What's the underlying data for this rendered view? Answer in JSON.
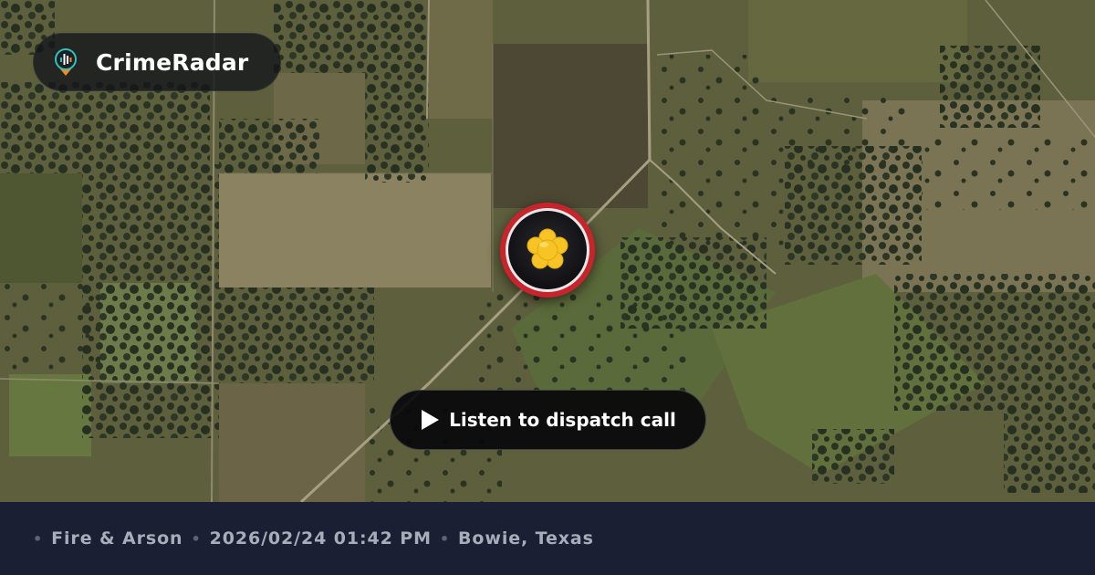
{
  "brand": {
    "name": "CrimeRadar",
    "logo_icon": "radar-pin-logo-icon",
    "colors": {
      "accent_teal": "#2ec4b6",
      "accent_orange": "#f08a24"
    }
  },
  "map": {
    "type": "satellite",
    "marker": {
      "icon": "fire-arson-icon",
      "ring_color": "#c8242b",
      "icon_color": "#f7c325"
    }
  },
  "dispatch": {
    "button_label": "Listen to dispatch call",
    "icon": "play-icon"
  },
  "footer": {
    "separator": "•",
    "category": "Fire & Arson",
    "datetime": "2026/02/24 01:42 PM",
    "location": "Bowie, Texas",
    "background": "#1a1f33"
  }
}
